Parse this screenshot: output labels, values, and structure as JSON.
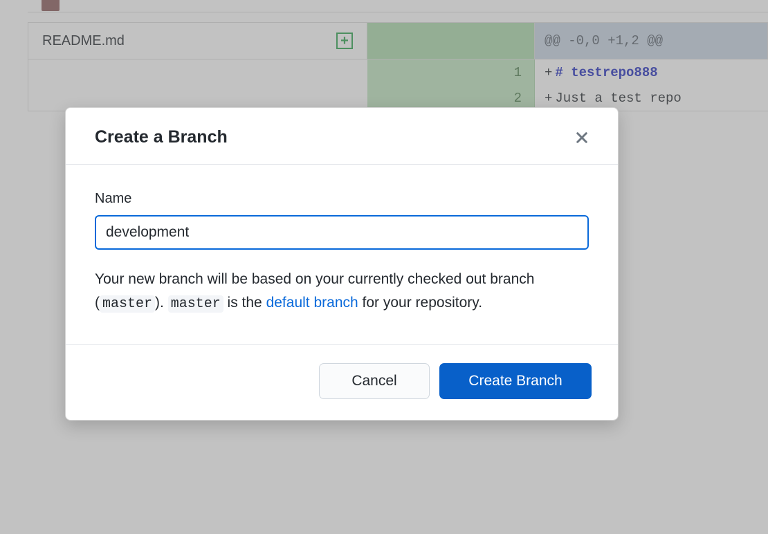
{
  "background": {
    "file_name": "README.md",
    "hunk_header": "@@ -0,0 +1,2 @@",
    "lines": [
      {
        "num": "1",
        "prefix": "+",
        "kind": "heading",
        "text": "# testrepo888"
      },
      {
        "num": "2",
        "prefix": "+",
        "kind": "plain",
        "text": "Just a test repo"
      }
    ]
  },
  "modal": {
    "title": "Create a Branch",
    "name_label": "Name",
    "name_value": "development",
    "help_pre": "Your new branch will be based on your currently checked out branch (",
    "code1": "master",
    "help_mid1": "). ",
    "code2": "master",
    "help_mid2": " is the ",
    "link_text": "default branch",
    "help_post": " for your repository.",
    "cancel_label": "Cancel",
    "create_label": "Create Branch"
  }
}
